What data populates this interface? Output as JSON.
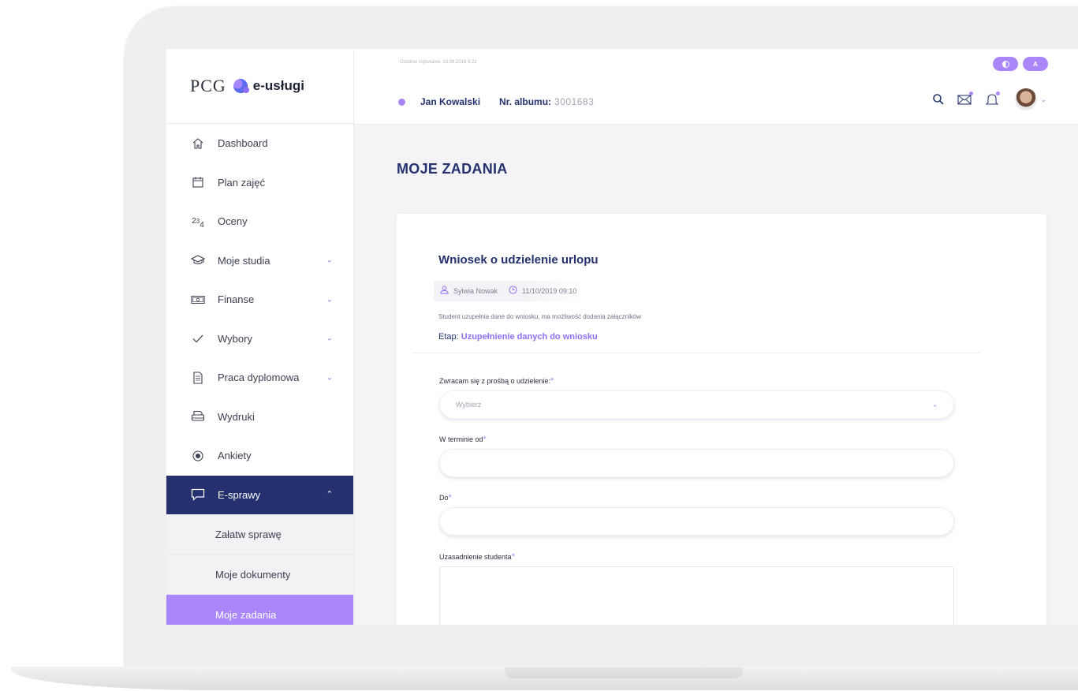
{
  "brand": {
    "pcg": "PCG",
    "name": "e-usługi"
  },
  "topbar": {
    "last_login": "Ostatnie logowanie: 13.08.2018 9:22",
    "contrast_toggle": "",
    "font_toggle": "A",
    "user_name": "Jan Kowalski",
    "album_label": "Nr. albumu:",
    "album_number": "3001683"
  },
  "sidebar": {
    "items": [
      {
        "label": "Dashboard",
        "icon": "home-icon"
      },
      {
        "label": "Plan zajęć",
        "icon": "calendar-icon"
      },
      {
        "label": "Oceny",
        "icon": "grades-icon"
      },
      {
        "label": "Moje studia",
        "icon": "graduation-cap-icon",
        "expandable": true
      },
      {
        "label": "Finanse",
        "icon": "money-icon",
        "expandable": true
      },
      {
        "label": "Wybory",
        "icon": "check-icon",
        "expandable": true
      },
      {
        "label": "Praca dyplomowa",
        "icon": "document-icon",
        "expandable": true
      },
      {
        "label": "Wydruki",
        "icon": "printer-icon"
      },
      {
        "label": "Ankiety",
        "icon": "radio-icon"
      },
      {
        "label": "E-sprawy",
        "icon": "chat-icon",
        "expandable": true,
        "expanded": true
      }
    ],
    "sub_items": [
      {
        "label": "Załatw sprawę"
      },
      {
        "label": "Moje dokumenty"
      },
      {
        "label": "Moje zadania",
        "selected": true
      }
    ]
  },
  "main": {
    "page_title": "MOJE ZADANIA",
    "task": {
      "title": "Wniosek o udzielenie urlopu",
      "author": "Sylwia Nowak",
      "datetime": "11/10/2019 09:10",
      "description": "Student uzupełnia dane do wniosku, ma możliwość dodania załączników",
      "stage_label": "Etap:",
      "stage_value": "Uzupełnienie danych do wniosku"
    },
    "form": {
      "request_type_label": "Zwracam się z prośbą o udzielenie:",
      "request_type_placeholder": "Wybierz",
      "date_from_label": "W terminie od",
      "date_to_label": "Do",
      "justification_label": "Uzasadnienie studenta",
      "required_mark": "*"
    }
  },
  "colors": {
    "navy": "#24316e",
    "accent_purple": "#a987fb",
    "active_nav": "#24316e",
    "selected_sub": "#a987fb"
  }
}
